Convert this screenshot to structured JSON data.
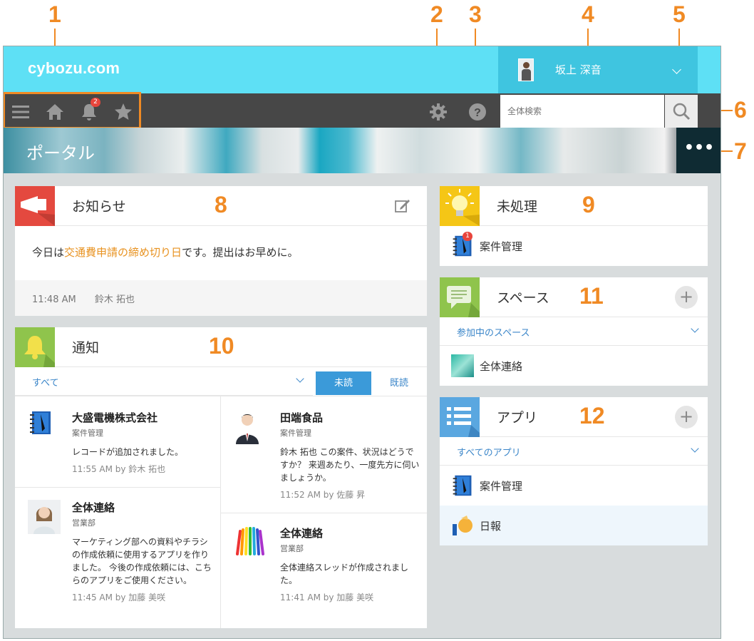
{
  "callouts": [
    "1",
    "2",
    "3",
    "4",
    "5",
    "6",
    "7",
    "8",
    "9",
    "10",
    "11",
    "12"
  ],
  "header": {
    "logo": "cybozu.com",
    "user_name": "坂上 深音",
    "notification_count": "2",
    "search_placeholder": "全体検索"
  },
  "banner": {
    "title": "ポータル",
    "more_label": "•••"
  },
  "notice": {
    "title": "お知らせ",
    "body_prefix": "今日は",
    "body_link": "交通費申請の締め切り日",
    "body_suffix": "です。提出はお早めに。",
    "time": "11:48 AM",
    "author": "鈴木 拓也"
  },
  "notifications": {
    "title": "通知",
    "filter": "すべて",
    "tab_unread": "未読",
    "tab_read": "既読",
    "items": [
      {
        "title": "大盛電機株式会社",
        "sub": "案件管理",
        "body": "レコードが追加されました。",
        "meta": "11:55 AM  by 鈴木 拓也"
      },
      {
        "title": "全体連絡",
        "sub": "営業部",
        "body": "マーケティング部への資料やチラシの作成依頼に使用するアプリを作りました。 今後の作成依頼には、こちらのアプリをご使用ください。",
        "meta": "11:45 AM  by 加藤 美咲"
      },
      {
        "title": "田端食品",
        "sub": "案件管理",
        "body": "鈴木 拓也 この案件、状況はどうですか？ 来週あたり、一度先方に伺いましょうか。",
        "meta": "11:52 AM  by 佐藤 昇"
      },
      {
        "title": "全体連絡",
        "sub": "営業部",
        "body": "全体連絡スレッドが作成されました。",
        "meta": "11:41 AM  by 加藤 美咲"
      }
    ]
  },
  "pending": {
    "title": "未処理",
    "items": [
      {
        "label": "案件管理",
        "badge": "1"
      }
    ]
  },
  "spaces": {
    "title": "スペース",
    "filter": "参加中のスペース",
    "items": [
      {
        "label": "全体連絡"
      }
    ]
  },
  "apps": {
    "title": "アプリ",
    "filter": "すべてのアプリ",
    "items": [
      {
        "label": "案件管理"
      },
      {
        "label": "日報"
      }
    ]
  },
  "colors": {
    "accent": "#f08a24",
    "topbar": "#5ee0f5",
    "link": "#3b86c9",
    "tab_active": "#3b9ad9"
  }
}
